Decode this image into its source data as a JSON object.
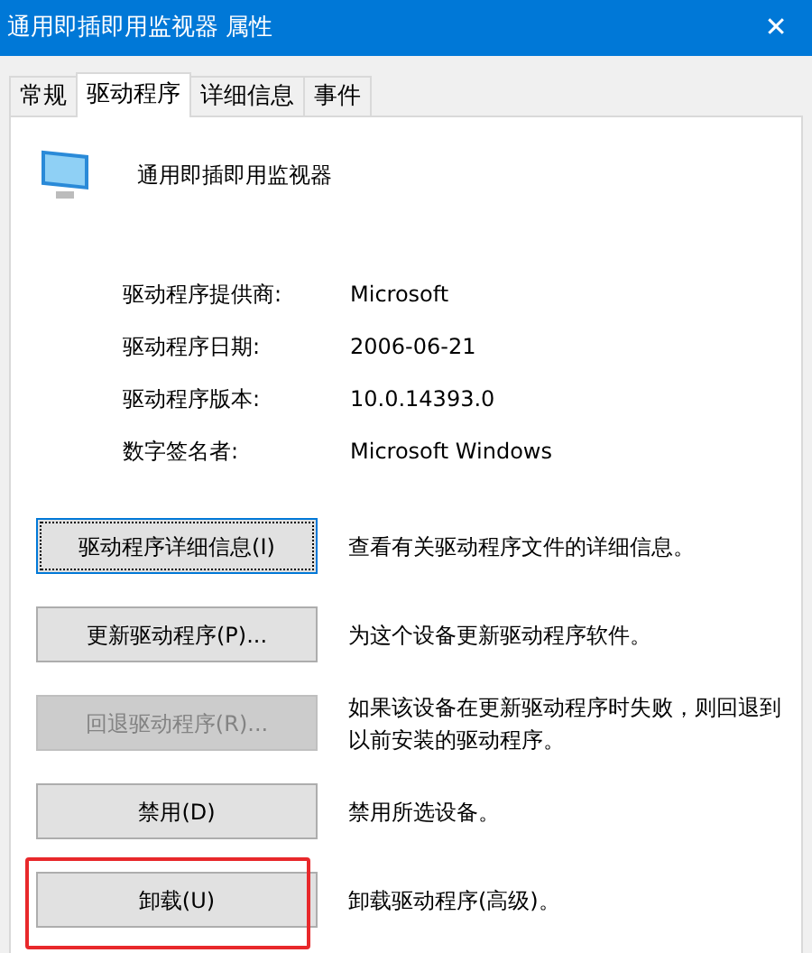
{
  "window": {
    "title": "通用即插即用监视器 属性",
    "close": "✕"
  },
  "tabs": [
    {
      "label": "常规",
      "selected": false
    },
    {
      "label": "驱动程序",
      "selected": true
    },
    {
      "label": "详细信息",
      "selected": false
    },
    {
      "label": "事件",
      "selected": false
    }
  ],
  "device": {
    "name": "通用即插即用监视器"
  },
  "properties": [
    {
      "label": "驱动程序提供商:",
      "value": "Microsoft"
    },
    {
      "label": "驱动程序日期:",
      "value": "2006-06-21"
    },
    {
      "label": "驱动程序版本:",
      "value": "10.0.14393.0"
    },
    {
      "label": "数字签名者:",
      "value": "Microsoft Windows"
    }
  ],
  "actions": [
    {
      "button": "驱动程序详细信息(I)",
      "description": "查看有关驱动程序文件的详细信息。",
      "focused": true,
      "disabled": false,
      "highlighted": false
    },
    {
      "button": "更新驱动程序(P)...",
      "description": "为这个设备更新驱动程序软件。",
      "focused": false,
      "disabled": false,
      "highlighted": false
    },
    {
      "button": "回退驱动程序(R)...",
      "description": "如果该设备在更新驱动程序时失败，则回退到以前安装的驱动程序。",
      "focused": false,
      "disabled": true,
      "highlighted": false
    },
    {
      "button": "禁用(D)",
      "description": "禁用所选设备。",
      "focused": false,
      "disabled": false,
      "highlighted": false
    },
    {
      "button": "卸载(U)",
      "description": "卸载驱动程序(高级)。",
      "focused": false,
      "disabled": false,
      "highlighted": true
    }
  ]
}
